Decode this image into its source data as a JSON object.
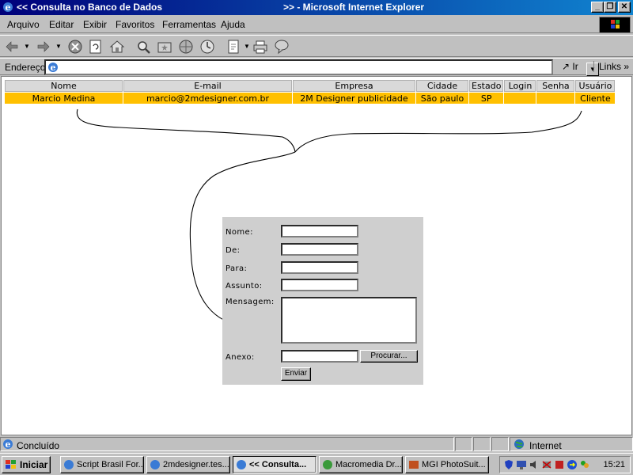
{
  "window": {
    "title_left": "<< Consulta no Banco de Dados",
    "title_right": ">> - Microsoft Internet Explorer",
    "minimize": "_",
    "restore": "❐",
    "close": "✕"
  },
  "menu": {
    "items": [
      "Arquivo",
      "Editar",
      "Exibir",
      "Favoritos",
      "Ferramentas",
      "Ajuda"
    ]
  },
  "toolbar": {
    "icons": [
      "back-icon",
      "forward-icon",
      "stop-icon",
      "refresh-icon",
      "home-icon",
      "search-icon",
      "favorites-icon",
      "history-icon",
      "media-icon",
      "edit-icon",
      "print-icon",
      "messenger-icon"
    ]
  },
  "address": {
    "label": "Endereço",
    "value": "",
    "go_label": "Ir",
    "links_label": "Links"
  },
  "table": {
    "headers": [
      "Nome",
      "E-mail",
      "Empresa",
      "Cidade",
      "Estado",
      "Login",
      "Senha",
      "Usuário"
    ],
    "row": [
      "Marcio Medina",
      "marcio@2mdesigner.com.br",
      "2M Designer publicidade",
      "São paulo",
      "SP",
      "",
      "",
      "Cliente"
    ],
    "row_color": "#ffc000"
  },
  "form": {
    "nome_label": "Nome:",
    "de_label": "De:",
    "para_label": "Para:",
    "assunto_label": "Assunto:",
    "mensagem_label": "Mensagem:",
    "anexo_label": "Anexo:",
    "browse_label": "Procurar...",
    "submit_label": "Enviar"
  },
  "status": {
    "text": "Concluído",
    "zone": "Internet"
  },
  "taskbar": {
    "start_label": "Iniciar",
    "tasks": [
      {
        "label": "Script Brasil For...",
        "active": false
      },
      {
        "label": "2mdesigner.tes...",
        "active": false
      },
      {
        "label": "<< Consulta...",
        "active": true
      },
      {
        "label": "Macromedia Dr...",
        "active": false
      },
      {
        "label": "MGI PhotoSuit...",
        "active": false
      }
    ],
    "clock": "15:21"
  }
}
